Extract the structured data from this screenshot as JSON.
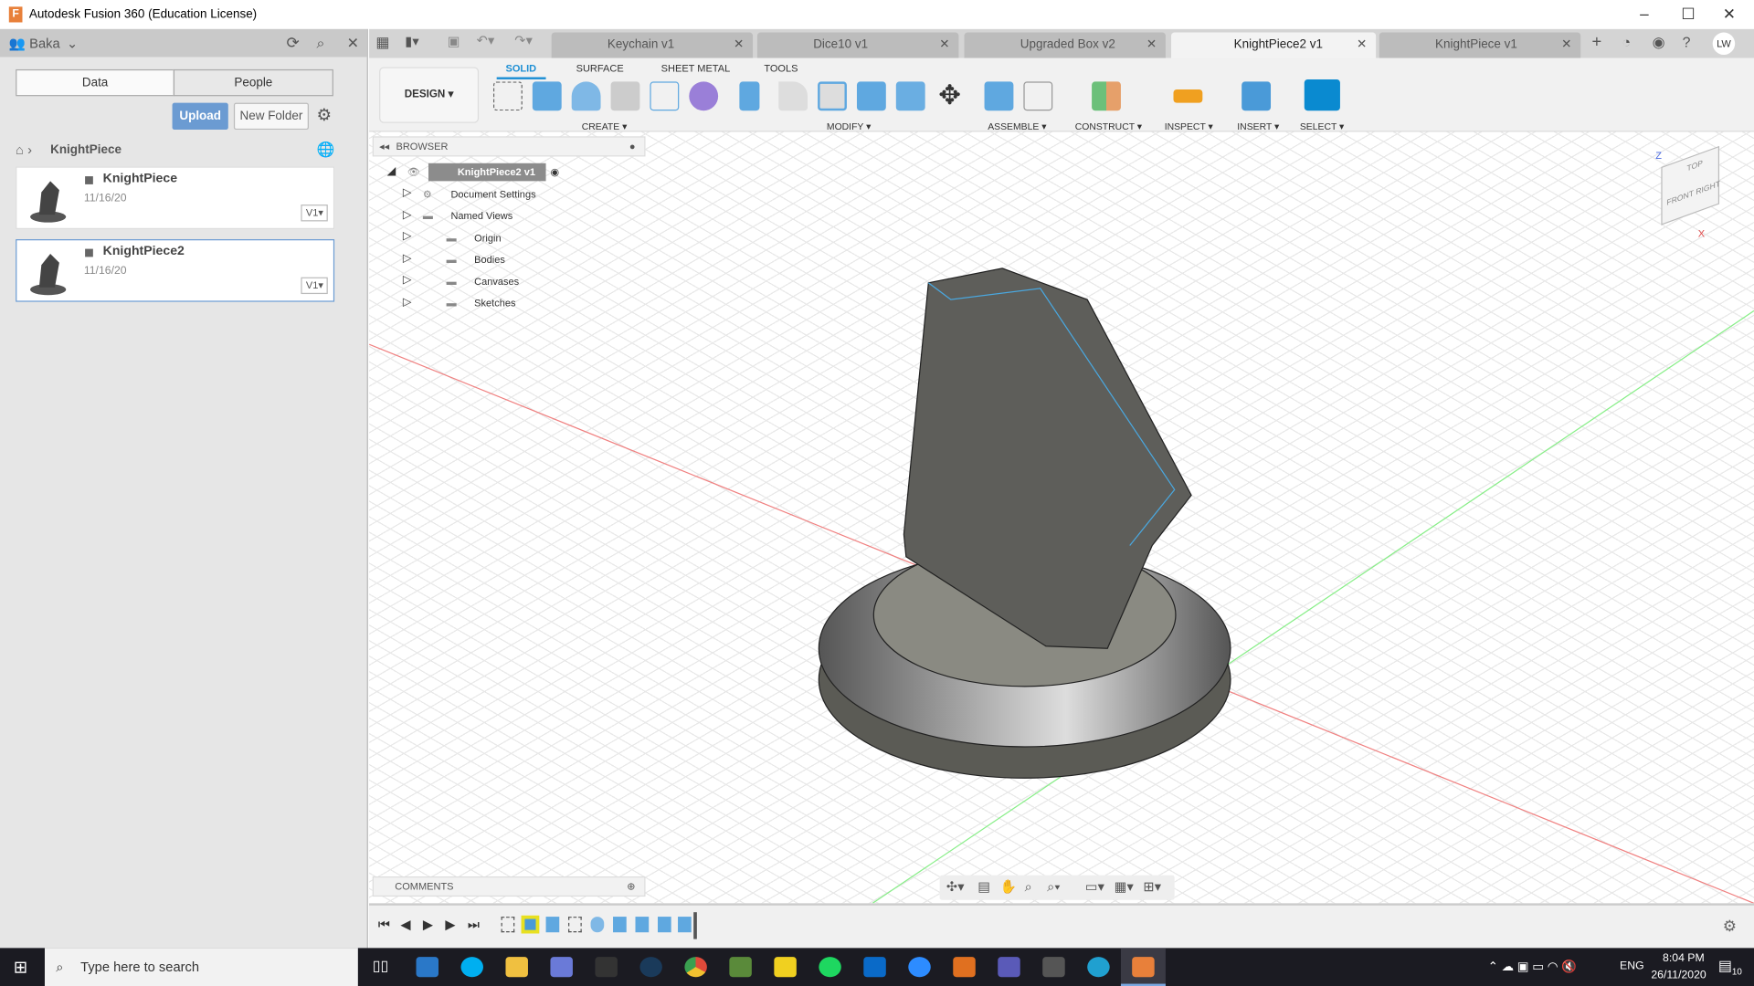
{
  "window": {
    "title": "Autodesk Fusion 360 (Education License)"
  },
  "data_panel": {
    "team": "Baka",
    "tabs": [
      "Data",
      "People"
    ],
    "upload": "Upload",
    "new_folder": "New Folder",
    "breadcrumb": "KnightPiece",
    "files": [
      {
        "name": "KnightPiece",
        "date": "11/16/20",
        "version": "V1"
      },
      {
        "name": "KnightPiece2",
        "date": "11/16/20",
        "version": "V1"
      }
    ]
  },
  "doc_tabs": [
    {
      "label": "Keychain v1",
      "active": false
    },
    {
      "label": "Dice10 v1",
      "active": false
    },
    {
      "label": "Upgraded Box v2",
      "active": false
    },
    {
      "label": "KnightPiece2 v1",
      "active": true
    },
    {
      "label": "KnightPiece v1",
      "active": false
    }
  ],
  "user_initials": "LW",
  "ribbon": {
    "workspace": "DESIGN",
    "tabs": [
      "SOLID",
      "SURFACE",
      "SHEET METAL",
      "TOOLS"
    ],
    "active_tab": "SOLID",
    "groups": [
      "CREATE",
      "MODIFY",
      "ASSEMBLE",
      "CONSTRUCT",
      "INSPECT",
      "INSERT",
      "SELECT"
    ]
  },
  "browser": {
    "title": "BROWSER",
    "root": "KnightPiece2 v1",
    "items": [
      "Document Settings",
      "Named Views",
      "Origin",
      "Bodies",
      "Canvases",
      "Sketches"
    ]
  },
  "comments": {
    "title": "COMMENTS"
  },
  "viewcube": {
    "top": "TOP",
    "front": "FRONT",
    "right": "RIGHT",
    "z": "Z",
    "x": "X"
  },
  "taskbar": {
    "search_placeholder": "Type here to search",
    "language": "ENG",
    "time": "8:04 PM",
    "date": "26/11/2020",
    "notifications": "10"
  },
  "colors": {
    "accent": "#1d8fd4",
    "upload": "#6b9bd2",
    "taskbar": "#1b1b22"
  }
}
